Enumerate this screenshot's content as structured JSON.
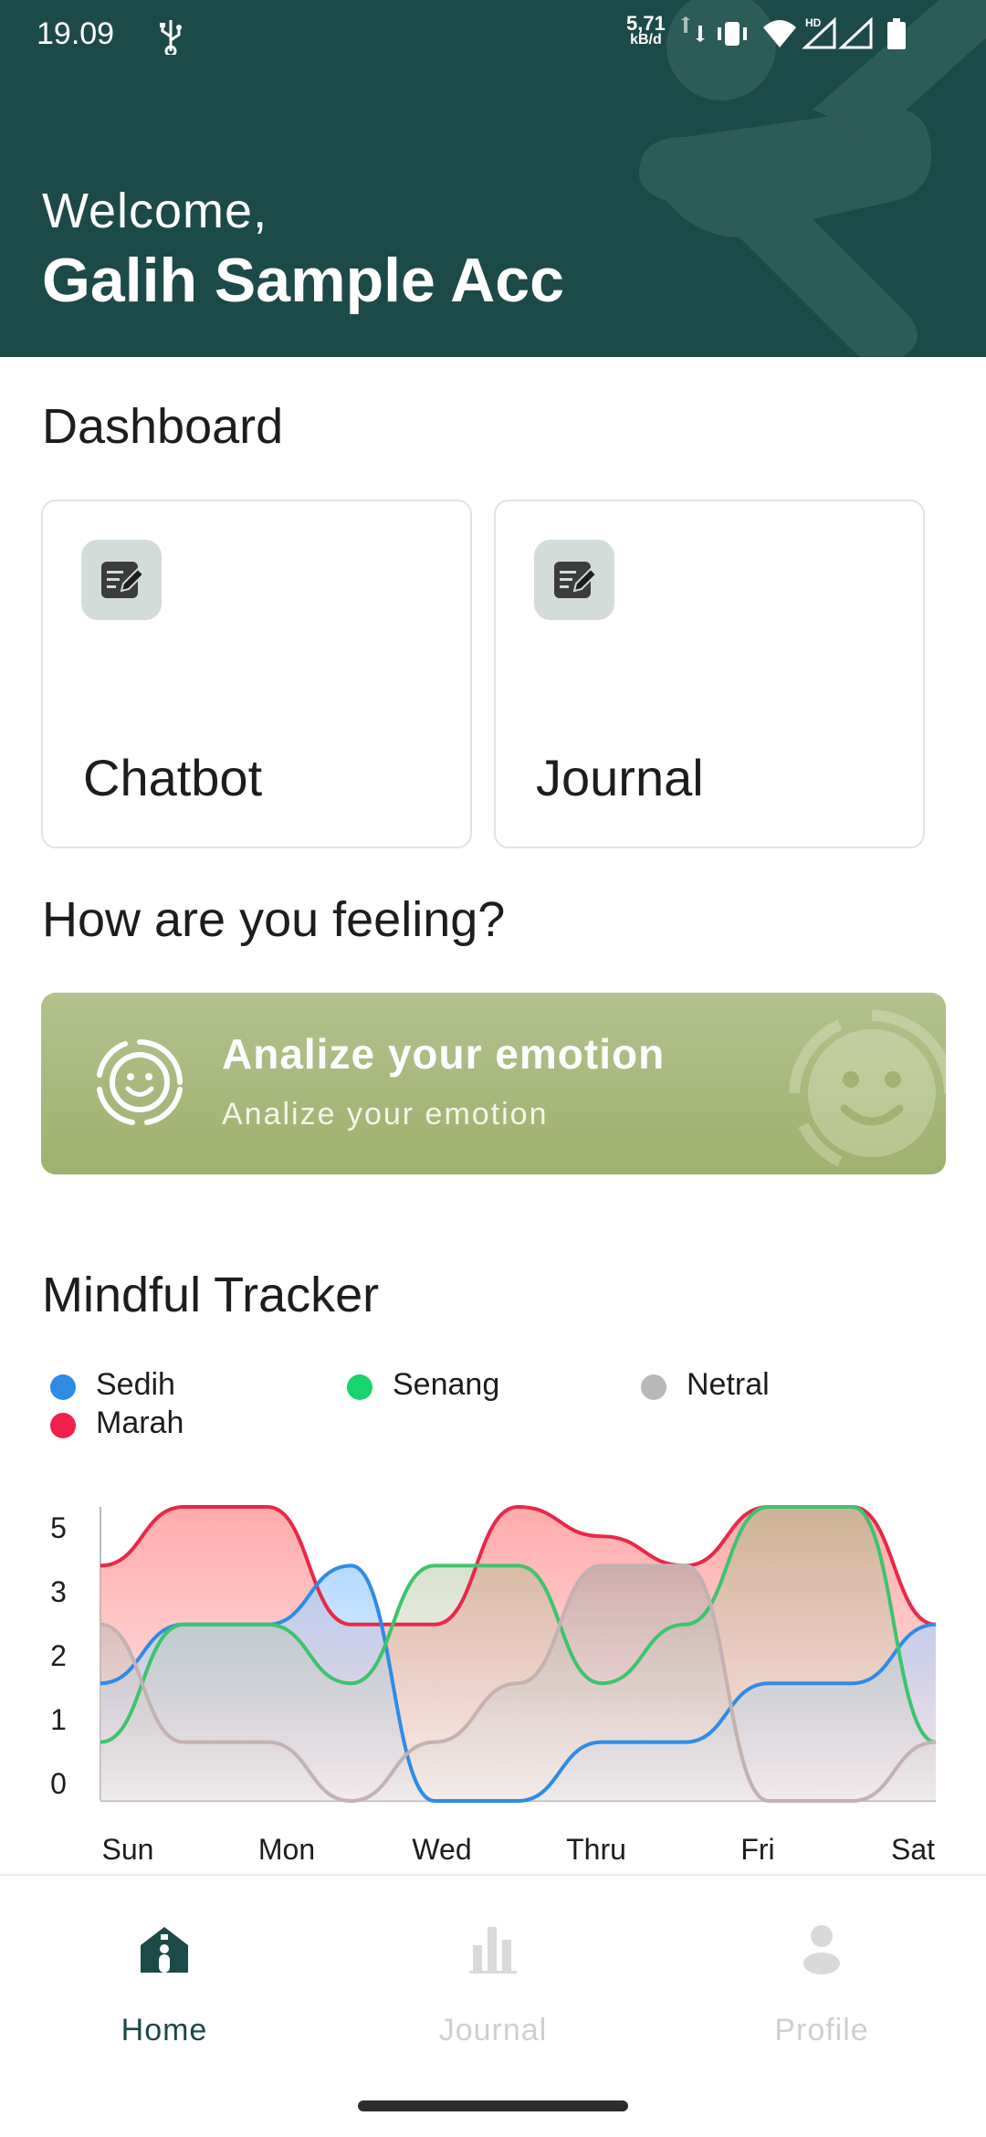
{
  "status_bar": {
    "time": "19.09",
    "net_speed_value": "5,71",
    "net_speed_unit": "kB/d",
    "network_type": "HD"
  },
  "header": {
    "greeting": "Welcome,",
    "user_name": "Galih Sample Acc"
  },
  "dashboard": {
    "title": "Dashboard",
    "cards": [
      {
        "label": "Chatbot",
        "icon": "edit-note-icon"
      },
      {
        "label": "Journal",
        "icon": "edit-note-icon"
      }
    ]
  },
  "feeling": {
    "title": "How are you feeling?",
    "banner_title": "Analize your emotion",
    "banner_subtitle": "Analize your emotion",
    "icon": "smiley-face-icon"
  },
  "tracker": {
    "title": "Mindful Tracker",
    "legend": [
      {
        "label": "Sedih",
        "color": "#2f8be6"
      },
      {
        "label": "Senang",
        "color": "#19d36c"
      },
      {
        "label": "Netral",
        "color": "#b9b9b9"
      },
      {
        "label": "Marah",
        "color": "#f0204a"
      }
    ]
  },
  "chart_data": {
    "type": "area",
    "categories": [
      "Sun",
      "Mon",
      "Wed",
      "Thru",
      "Fri",
      "Sat"
    ],
    "y_ticks": [
      "5",
      "3",
      "2",
      "1",
      "0"
    ],
    "x": [
      "Sun",
      "",
      "Mon",
      "",
      "Wed",
      "",
      "Thru",
      "",
      "Fri",
      "",
      "Sat"
    ],
    "series": [
      {
        "name": "Marah",
        "color": "#e8284a",
        "values": [
          4,
          5,
          5,
          3,
          3,
          5,
          4.5,
          4,
          5,
          5,
          3
        ]
      },
      {
        "name": "Sedih",
        "color": "#2f8be6",
        "values": [
          2,
          3,
          3,
          4,
          0,
          0,
          1,
          1,
          2,
          2,
          3
        ]
      },
      {
        "name": "Senang",
        "color": "#3dc46d",
        "values": [
          1,
          3,
          3,
          2,
          4,
          4,
          2,
          3,
          5,
          5,
          1
        ]
      },
      {
        "name": "Netral",
        "color": "#c4b1b1",
        "values": [
          3,
          1,
          1,
          0,
          1,
          2,
          4,
          4,
          0,
          0,
          1
        ]
      }
    ],
    "ylim": [
      0,
      5
    ],
    "grid": false,
    "legend_position": "top"
  },
  "bottom_nav": {
    "items": [
      {
        "label": "Home",
        "icon": "home-icon",
        "active": true
      },
      {
        "label": "Journal",
        "icon": "bar-chart-icon",
        "active": false
      },
      {
        "label": "Profile",
        "icon": "person-icon",
        "active": false
      }
    ]
  }
}
